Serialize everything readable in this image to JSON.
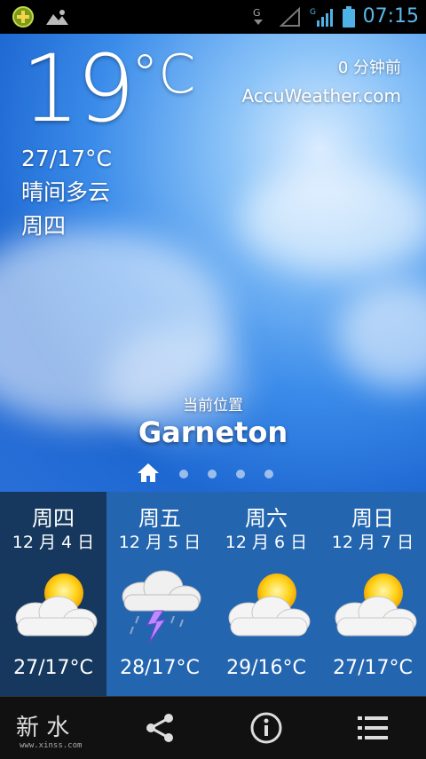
{
  "statusbar": {
    "time": "07:15",
    "net1": "G",
    "net2": "G"
  },
  "current": {
    "temperature": "19",
    "unit": "°C",
    "range": "27/17°C",
    "condition": "晴间多云",
    "weekday": "周四",
    "updated": "0 分钟前",
    "source": "AccuWeather.com"
  },
  "location": {
    "label": "当前位置",
    "name": "Garneton"
  },
  "pager": {
    "count": 5,
    "active": 0
  },
  "forecast": [
    {
      "day": "周四",
      "date": "12 月 4 日",
      "temp": "27/17°C",
      "icon": "partly-cloudy-icon"
    },
    {
      "day": "周五",
      "date": "12 月 5 日",
      "temp": "28/17°C",
      "icon": "thunderstorm-icon"
    },
    {
      "day": "周六",
      "date": "12 月 6 日",
      "temp": "29/16°C",
      "icon": "partly-cloudy-icon"
    },
    {
      "day": "周日",
      "date": "12 月 7 日",
      "temp": "27/17°C",
      "icon": "partly-cloudy-icon"
    }
  ],
  "bottombar": {
    "logo_text": "新  水",
    "logo_url": "www.xinss.com",
    "icons": [
      "share-icon",
      "info-icon",
      "menu-icon"
    ]
  },
  "colors": {
    "sky_top": "#2a6fd8",
    "forecast_bg": "#266ebe",
    "active_day_bg": "#16385e",
    "statusbar_text": "#5ab8ea"
  }
}
